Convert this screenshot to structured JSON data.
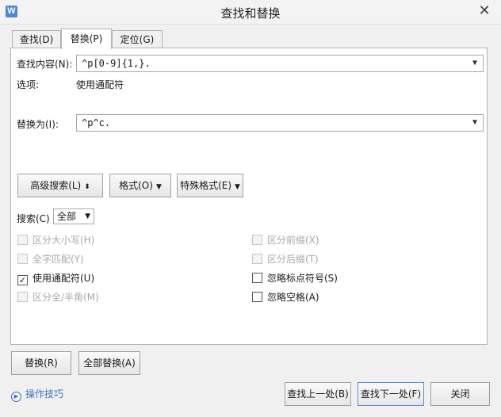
{
  "window": {
    "title": "查找和替换",
    "close_glyph": "✕",
    "app_icon_glyph": "W"
  },
  "tabs": [
    {
      "label": "查找(D)"
    },
    {
      "label": "替换(P)"
    },
    {
      "label": "定位(G)"
    }
  ],
  "find": {
    "label": "查找内容(N):",
    "value": "^p[0-9]{1,}."
  },
  "options": {
    "label": "选项:",
    "value": "使用通配符"
  },
  "replace": {
    "label": "替换为(I):",
    "value": "^p^c."
  },
  "buttons": {
    "advanced_search": "高级搜索(L)",
    "format": "格式(O)",
    "special_format": "特殊格式(E)",
    "replace": "替换(R)",
    "replace_all": "全部替换(A)",
    "find_prev": "查找上一处(B)",
    "find_next": "查找下一处(F)",
    "close": "关闭"
  },
  "search": {
    "label": "搜索(C)",
    "value": "全部"
  },
  "checkboxes": {
    "match_case": {
      "label": "区分大小写(H)",
      "checked": false,
      "enabled": false
    },
    "whole_word": {
      "label": "全字匹配(Y)",
      "checked": false,
      "enabled": false
    },
    "wildcards": {
      "label": "使用通配符(U)",
      "checked": true,
      "enabled": true
    },
    "full_half_width": {
      "label": "区分全/半角(M)",
      "checked": false,
      "enabled": false
    },
    "match_prefix": {
      "label": "区分前缀(X)",
      "checked": false,
      "enabled": false
    },
    "match_suffix": {
      "label": "区分后缀(T)",
      "checked": false,
      "enabled": false
    },
    "ignore_punct": {
      "label": "忽略标点符号(S)",
      "checked": false,
      "enabled": true
    },
    "ignore_space": {
      "label": "忽略空格(A)",
      "checked": false,
      "enabled": true
    }
  },
  "tips": {
    "label": "操作技巧"
  },
  "colors": {
    "link": "#3b72c4",
    "app_icon": "#4a86d9"
  }
}
